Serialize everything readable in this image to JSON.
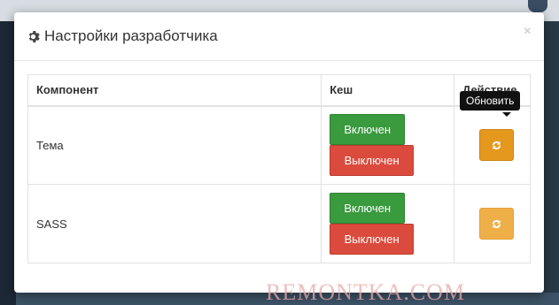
{
  "modal": {
    "title": "Настройки разработчика",
    "close_glyph": "×",
    "table": {
      "headers": [
        "Компонент",
        "Кеш",
        "Действие"
      ],
      "rows": [
        {
          "component": "Тема",
          "enabled_label": "Включен",
          "disabled_label": "Выключен"
        },
        {
          "component": "SASS",
          "enabled_label": "Включен",
          "disabled_label": "Выключен"
        }
      ]
    },
    "tooltip": "Обновить"
  },
  "watermark": "REMONTKA.COM",
  "colors": {
    "enabled": "#3a9a3e",
    "disabled": "#db4b3d",
    "refresh": "#e5981e"
  },
  "icons": {
    "title": "gear-icon",
    "action": "refresh-icon",
    "close": "close-icon"
  }
}
